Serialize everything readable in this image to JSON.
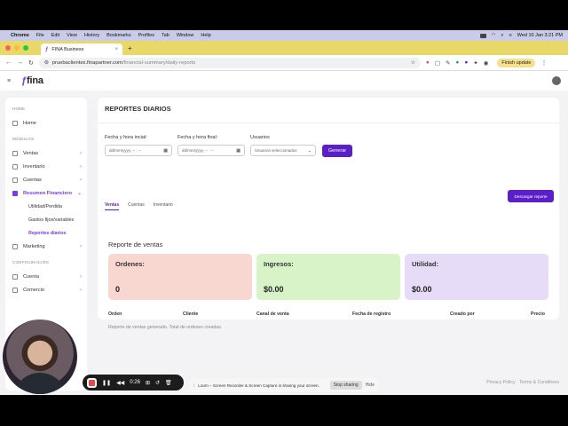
{
  "menubar": {
    "items": [
      "Chrome",
      "File",
      "Edit",
      "View",
      "History",
      "Bookmarks",
      "Profiles",
      "Tab",
      "Window",
      "Help"
    ],
    "clock": "Wed 10 Jan  3:21 PM"
  },
  "browser": {
    "tab_title": "FINA Business",
    "url_host": "pruebaclientes.finapartner.com",
    "url_path": "/financial-summary/daily-reports",
    "finish_update": "Finish update",
    "colors": {
      "tabbar": "#e8d86a"
    }
  },
  "app": {
    "logo": "fina",
    "accent": "#7c3aed",
    "sidebar": {
      "section_home": "HOME",
      "home": "Home",
      "section_modules": "MÓDULOS",
      "modules": [
        {
          "label": "Ventas"
        },
        {
          "label": "Inventario"
        },
        {
          "label": "Cuentas"
        },
        {
          "label": "Resumen Financiero"
        }
      ],
      "subitems": [
        "Utilidad/Perdida",
        "Gastos fijos/variables",
        "Reportes diarios"
      ],
      "marketing": "Marketing",
      "section_config": "CONFIGURACIÓN",
      "cuenta": "Cuenta",
      "comercio": "Comercio"
    },
    "page": {
      "title": "REPORTES DIARIOS",
      "start_label": "Fecha y hora incial:",
      "start_placeholder": "dd/mm/yyyy, -- : --",
      "end_label": "Fecha y hora final:",
      "end_placeholder": "dd/mm/yyyy, -- : --",
      "users_label": "Usuarios",
      "users_value": "Usuarios seleccionados",
      "generate": "Generar",
      "tabs": [
        "Ventas",
        "Cuentas",
        "Inventario"
      ],
      "download": "Descargar reporte",
      "report_title": "Reporte de ventas",
      "cards": [
        {
          "label": "Ordenes:",
          "value": "0",
          "color": "#f8d7d0"
        },
        {
          "label": "Ingresos:",
          "value": "$0.00",
          "color": "#d8f3c8"
        },
        {
          "label": "Utilidad:",
          "value": "$0.00",
          "color": "#e6dcf7"
        }
      ],
      "columns": [
        "Orden",
        "Cliente",
        "Canal de venta",
        "Fecha de registro",
        "Creado por",
        "Precio"
      ],
      "note": "Reporte de ventas generado. Total de ordenes creadas."
    },
    "footer": "Privacy Policy · Terms & Conditions"
  },
  "recorder": {
    "time": "0:26",
    "share_text": "Loom – Screen Recorder & Screen Capture is sharing your screen.",
    "stop_sharing": "Stop sharing",
    "hide": "Hide"
  }
}
